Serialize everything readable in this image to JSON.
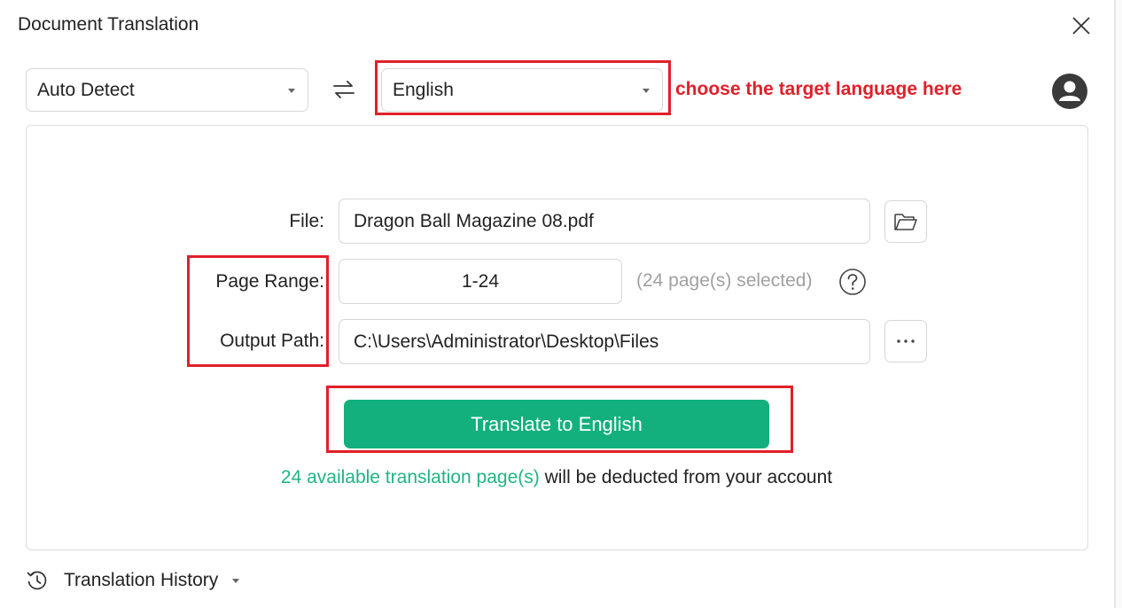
{
  "window": {
    "title": "Document Translation",
    "close_icon": "close-icon"
  },
  "languages": {
    "source": "Auto Detect",
    "swap_icon": "swap-arrows-icon",
    "target": "English",
    "annotation": "choose the target language here",
    "annotation_color": "#e0202a"
  },
  "form": {
    "file_label": "File:",
    "file_value": "Dragon Ball Magazine 08.pdf",
    "page_range_label": "Page Range:",
    "page_range_value": "1-24",
    "pages_selected": "(24 page(s) selected)",
    "output_label": "Output Path:",
    "output_value": "C:\\Users\\Administrator\\Desktop\\Files"
  },
  "action": {
    "translate_label": "Translate to English",
    "button_color": "#13b07e",
    "note_highlight": "24 available translation page(s)",
    "note_rest": " will be deducted from your account"
  },
  "footer": {
    "history_label": "Translation History"
  }
}
